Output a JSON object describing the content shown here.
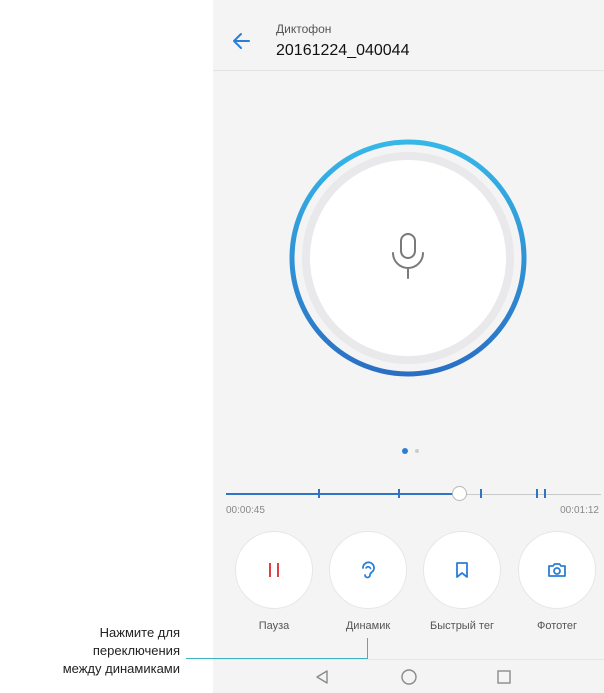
{
  "header": {
    "app_name": "Диктофон",
    "file_name": "20161224_040044",
    "back_icon": "arrow-left-icon"
  },
  "recorder": {
    "center_icon": "microphone-icon",
    "ring_colors": {
      "start": "#36b7e8",
      "end": "#2a6fc4"
    },
    "page_indicator": {
      "pages": 2,
      "active": 1
    }
  },
  "timeline": {
    "start_time": "00:00:45",
    "end_time": "00:01:12",
    "progress": 0.625,
    "accent_color": "#2e74c8"
  },
  "controls": [
    {
      "label": "Пауза",
      "icon": "pause-icon",
      "color": "#e04040"
    },
    {
      "label": "Динамик",
      "icon": "ear-icon",
      "color": "#2a7fd5"
    },
    {
      "label": "Быстрый тег",
      "icon": "bookmark-icon",
      "color": "#2a7fd5"
    },
    {
      "label": "Фототег",
      "icon": "camera-icon",
      "color": "#2a7fd5"
    }
  ],
  "navbar": {
    "back": "nav-back-icon",
    "home": "nav-home-icon",
    "recents": "nav-recents-icon"
  },
  "callout": {
    "line1": "Нажмите для",
    "line2": "переключения",
    "line3": "между динамиками",
    "color": "#3bb3c3"
  }
}
